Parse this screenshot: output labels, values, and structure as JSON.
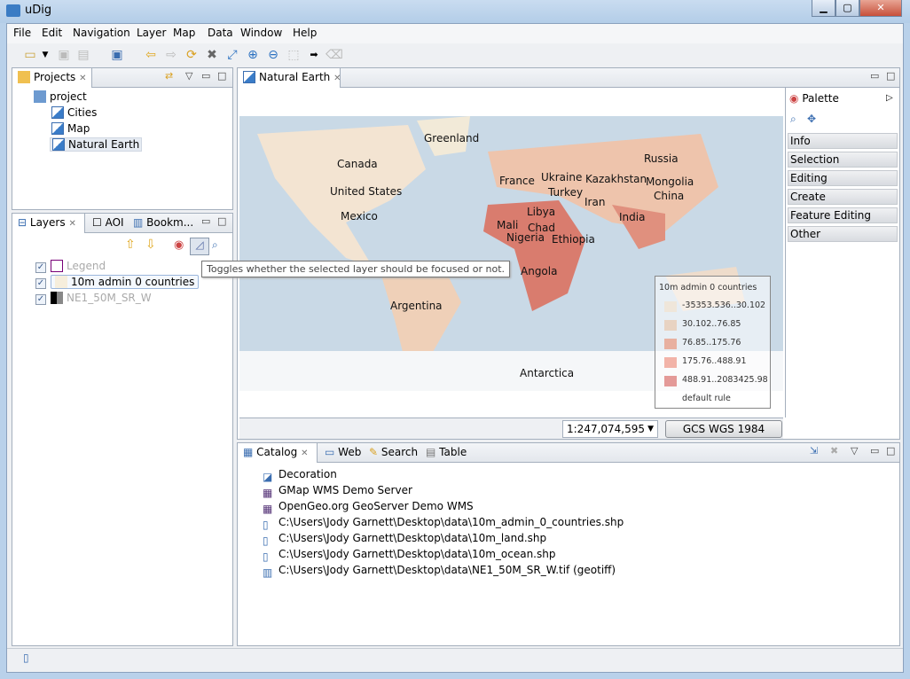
{
  "window": {
    "title": "uDig",
    "controls": [
      "minimize",
      "maximize",
      "close"
    ]
  },
  "menu": [
    "File",
    "Edit",
    "Navigation",
    "Layer",
    "Map",
    "Data",
    "Window",
    "Help"
  ],
  "toolbar": [
    "new-icon",
    "dropdown-icon",
    "save-icon",
    "save-all-icon",
    "new-map-icon",
    "back-icon",
    "forward-icon",
    "refresh-icon",
    "stop-icon",
    "zoom-extent-icon",
    "zoom-in-icon",
    "zoom-out-icon",
    "zoom-selection-icon",
    "next-icon",
    "eraser-icon"
  ],
  "projects": {
    "tab": "Projects",
    "root": "project",
    "items": [
      "Cities",
      "Map",
      "Natural Earth"
    ],
    "selected": "Natural Earth"
  },
  "layers_panel": {
    "tabs": [
      "Layers",
      "AOI",
      "Bookm..."
    ],
    "layers": [
      {
        "name": "Legend",
        "checked": true,
        "dimmed": true
      },
      {
        "name": "10m admin 0 countries",
        "checked": true,
        "dimmed": false
      },
      {
        "name": "NE1_50M_SR_W",
        "checked": true,
        "dimmed": true
      }
    ],
    "tooltip": "Toggles whether the selected layer should be focused or not."
  },
  "map_editor": {
    "tab": "Natural Earth",
    "labels": [
      "Greenland",
      "Canada",
      "United States",
      "Mexico",
      "Russia",
      "Ukraine",
      "France",
      "Kazakhstan",
      "Mongolia",
      "Turkey",
      "China",
      "Iran",
      "Libya",
      "Mali",
      "Chad",
      "Nigeria",
      "Ethiopia",
      "India",
      "Angola",
      "Argentina",
      "Antarctica"
    ],
    "legend": {
      "title": "10m admin 0 countries",
      "rules": [
        "-35353.536..30.102",
        "30.102..76.85",
        "76.85..175.76",
        "175.76..488.91",
        "488.91..2083425.98",
        "default rule"
      ],
      "colors": [
        "#efe6da",
        "#e8d3c2",
        "#e8b0a0",
        "#f2b3a8",
        "#e49a98"
      ]
    },
    "scale": "1:247,074,595",
    "crs": "GCS WGS 1984"
  },
  "palette": {
    "title": "Palette",
    "categories": [
      "Info",
      "Selection",
      "Editing",
      "Create",
      "Feature Editing",
      "Other"
    ]
  },
  "catalog": {
    "tabs": [
      "Catalog",
      "Web",
      "Search",
      "Table"
    ],
    "items": [
      "Decoration",
      "GMap WMS Demo Server",
      "OpenGeo.org GeoServer Demo WMS",
      "C:\\Users\\Jody Garnett\\Desktop\\data\\10m_admin_0_countries.shp",
      "C:\\Users\\Jody Garnett\\Desktop\\data\\10m_land.shp",
      "C:\\Users\\Jody Garnett\\Desktop\\data\\10m_ocean.shp",
      "C:\\Users\\Jody Garnett\\Desktop\\data\\NE1_50M_SR_W.tif (geotiff)"
    ]
  }
}
